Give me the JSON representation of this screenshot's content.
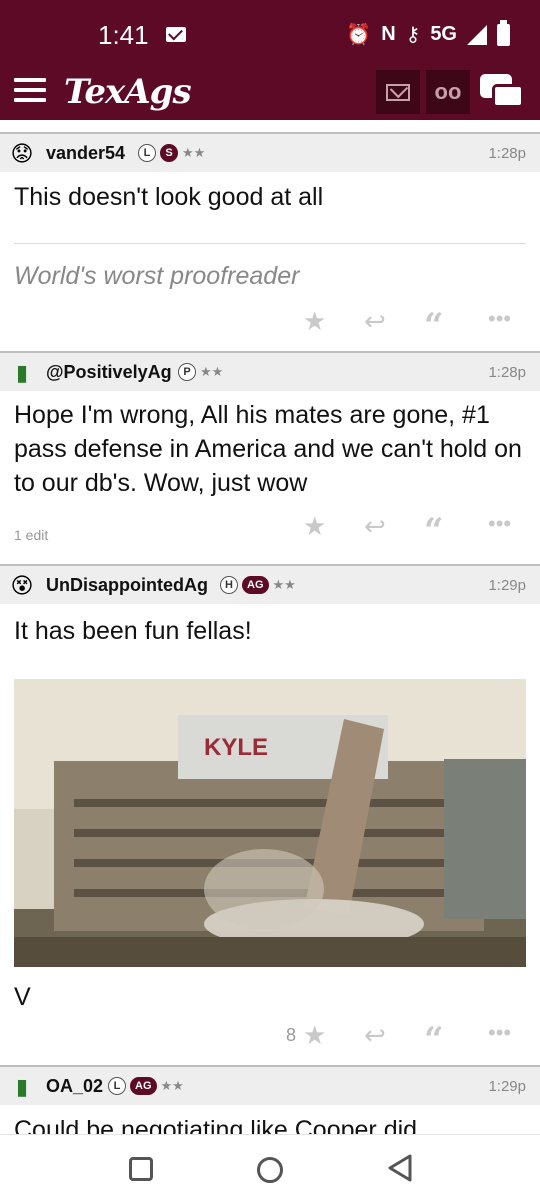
{
  "status_bar": {
    "time": "1:41",
    "network": "5G"
  },
  "app": {
    "logo": "TexAgs"
  },
  "posts": [
    {
      "username": "vander54",
      "badges": [
        "L",
        "S"
      ],
      "stars": "★★",
      "time": "1:28p",
      "body": "This doesn't look good at all",
      "signature": "World's worst proofreader"
    },
    {
      "username": "@PositivelyAg",
      "badges": [
        "P"
      ],
      "stars": "★★",
      "time": "1:28p",
      "body": "Hope I'm wrong, All his mates are gone, #1 pass defense in America and we can't hold on to our db's. Wow, just wow",
      "edits": "1 edit"
    },
    {
      "username": "UnDisappointedAg",
      "badges": [
        "H",
        "AG"
      ],
      "stars": "★★",
      "time": "1:29p",
      "body": "It has been fun fellas!",
      "image_text": "KYLE",
      "trailing": "V",
      "star_count": "8"
    },
    {
      "username": "OA_02",
      "badges": [
        "L",
        "AG"
      ],
      "stars": "★★",
      "time": "1:29p",
      "body": "Could be negotiating like Cooper did"
    }
  ],
  "colors": {
    "brand": "#5d0a26",
    "header_bg": "#eeeeee"
  }
}
